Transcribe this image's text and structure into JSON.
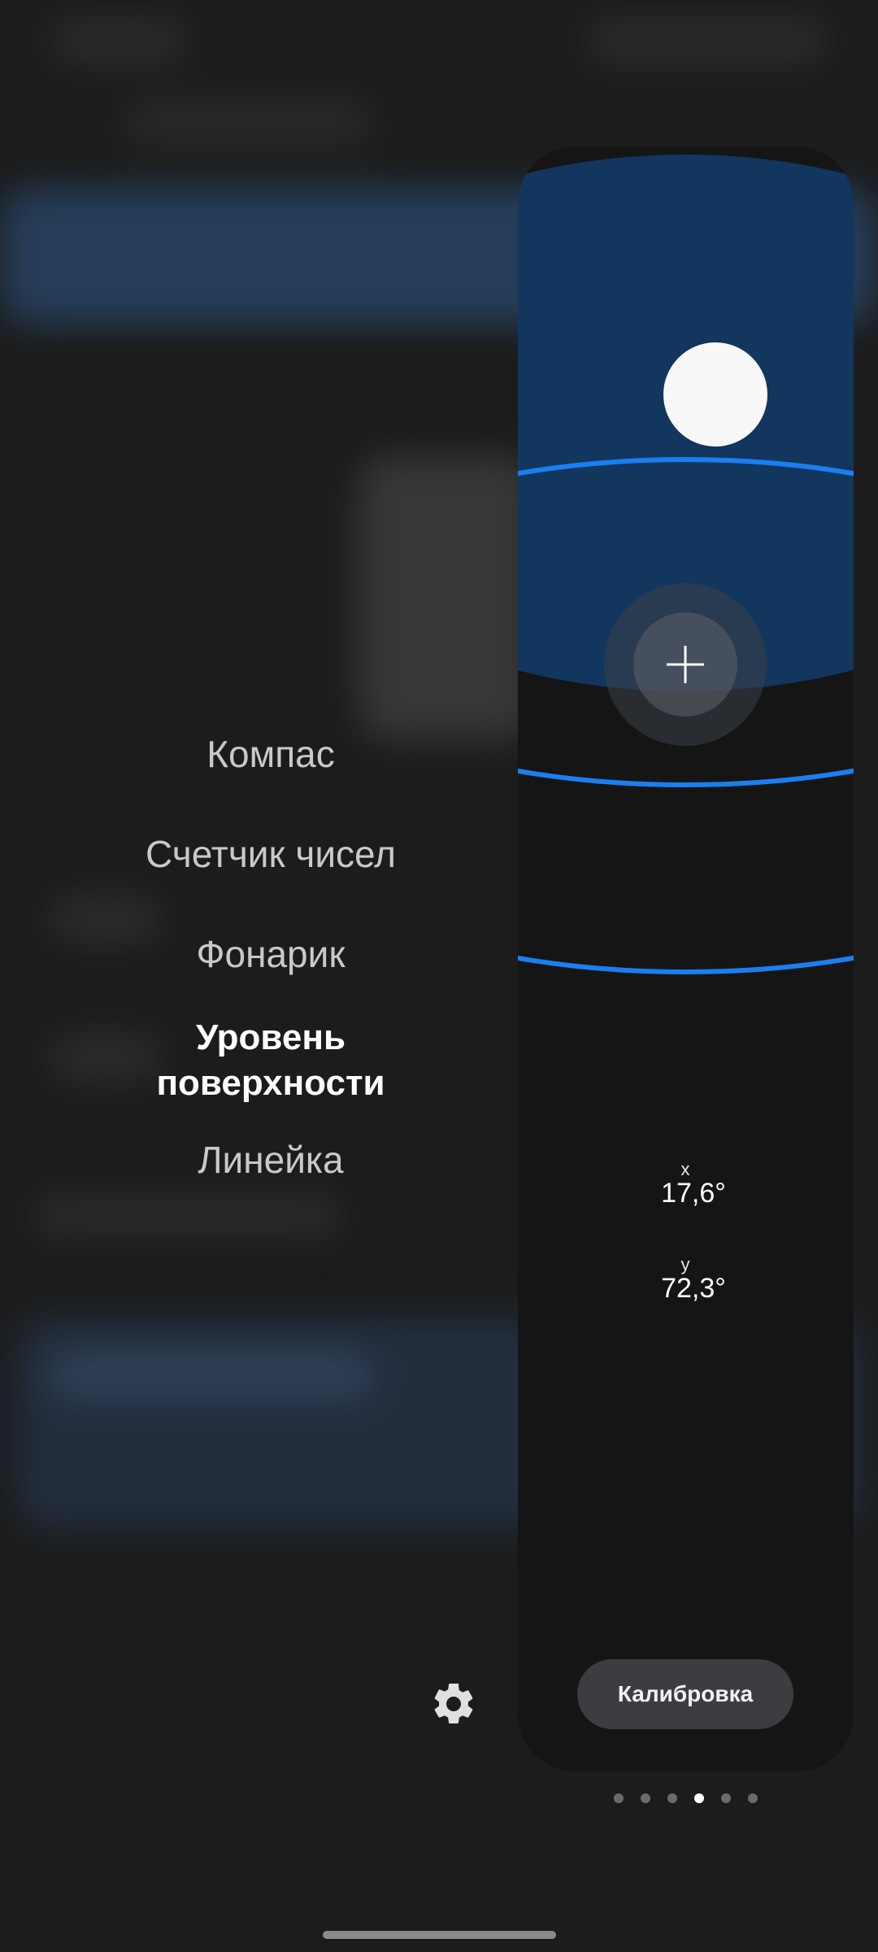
{
  "menu": {
    "items": [
      {
        "label": "Компас"
      },
      {
        "label": "Счетчик чисел"
      },
      {
        "label": "Фонарик"
      },
      {
        "label": "Уровень поверхности"
      },
      {
        "label": "Линейка"
      }
    ],
    "selected_index": 3
  },
  "level": {
    "x_label": "x",
    "x_value": "17,6°",
    "y_label": "y",
    "y_value": "72,3°",
    "calibrate_label": "Калибровка"
  },
  "pager": {
    "page_count": 6,
    "current_page": 4
  },
  "colors": {
    "accent": "#1a7ff0",
    "water": "#12365e",
    "panel": "#151515",
    "bubble": "#f8f8f8"
  },
  "icons": {
    "settings": "gear-icon",
    "crosshair": "plus-icon"
  }
}
